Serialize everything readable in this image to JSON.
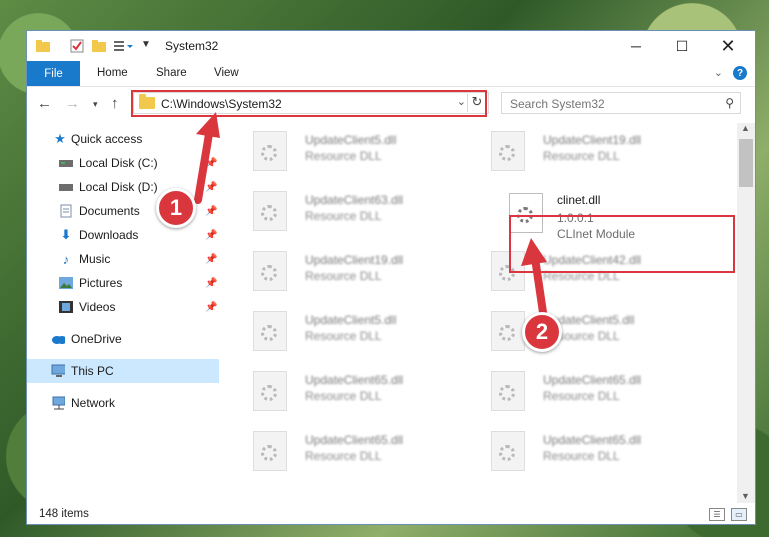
{
  "window": {
    "title": "System32",
    "minimize_icon": "minimize-icon",
    "maximize_icon": "maximize-icon",
    "close_icon": "close-icon"
  },
  "ribbon": {
    "tabs": [
      {
        "label": "File"
      },
      {
        "label": "Home"
      },
      {
        "label": "Share"
      },
      {
        "label": "View"
      }
    ],
    "help_label": "?"
  },
  "nav": {
    "address": "C:\\Windows\\System32",
    "search_placeholder": "Search System32"
  },
  "sidebar": {
    "items": [
      {
        "label": "Quick access",
        "icon": "star-icon"
      },
      {
        "label": "Local Disk (C:)",
        "icon": "drive-icon"
      },
      {
        "label": "Local Disk (D:)",
        "icon": "drive-icon"
      },
      {
        "label": "Documents",
        "icon": "document-icon"
      },
      {
        "label": "Downloads",
        "icon": "download-icon"
      },
      {
        "label": "Music",
        "icon": "music-icon"
      },
      {
        "label": "Pictures",
        "icon": "pictures-icon"
      },
      {
        "label": "Videos",
        "icon": "video-icon"
      },
      {
        "label": "OneDrive",
        "icon": "cloud-icon"
      },
      {
        "label": "This PC",
        "icon": "computer-icon"
      },
      {
        "label": "Network",
        "icon": "network-icon"
      }
    ]
  },
  "files": [
    {
      "name": "UpdateClient5.dll",
      "type": "Resource DLL"
    },
    {
      "name": "UpdateClient19.dll",
      "type": "Resource DLL"
    },
    {
      "name": "UpdateClient63.dll",
      "type": "Resource DLL"
    },
    {
      "name": "clinet.dll",
      "version": "1.0.0.1",
      "type": "CLInet Module"
    },
    {
      "name": "UpdateClient19.dll",
      "type": "Resource DLL"
    },
    {
      "name": "UpdateClient42.dll",
      "type": "Resource DLL"
    },
    {
      "name": "UpdateClient5.dll",
      "type": "Resource DLL"
    },
    {
      "name": "UpdateClient5.dll",
      "type": "Resource DLL"
    },
    {
      "name": "UpdateClient65.dll",
      "type": "Resource DLL"
    },
    {
      "name": "UpdateClient65.dll",
      "type": "Resource DLL"
    },
    {
      "name": "UpdateClient65.dll",
      "type": "Resource DLL"
    },
    {
      "name": "UpdateClient65.dll",
      "type": "Resource DLL"
    }
  ],
  "status": {
    "count": "148 items"
  },
  "callouts": [
    {
      "number": "1"
    },
    {
      "number": "2"
    }
  ]
}
